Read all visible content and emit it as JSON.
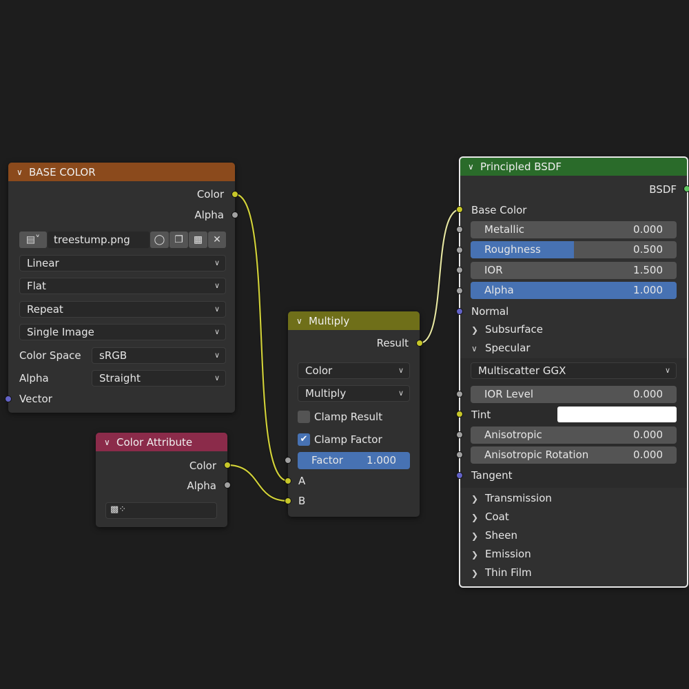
{
  "image_node": {
    "title": "BASE COLOR",
    "header_color": "#8b4a1c",
    "outputs": [
      "Color",
      "Alpha"
    ],
    "image_name": "treestump.png",
    "interpolation": "Linear",
    "projection": "Flat",
    "extension": "Repeat",
    "source": "Single Image",
    "color_space_label": "Color Space",
    "color_space": "sRGB",
    "alpha_label": "Alpha",
    "alpha_mode": "Straight",
    "vector_input": "Vector",
    "icons": [
      "image-browse-icon",
      "fake-user-shield-icon",
      "duplicate-icon",
      "pack-icon",
      "unlink-x-icon"
    ]
  },
  "color_attribute_node": {
    "title": "Color Attribute",
    "header_color": "#8b2b4a",
    "outputs": [
      "Color",
      "Alpha"
    ],
    "name_value": "",
    "icon": "color-attribute-icon"
  },
  "mix_node": {
    "title": "Multiply",
    "header_color": "#6f6f19",
    "output": "Result",
    "data_type": "Color",
    "blend_type": "Multiply",
    "clamp_result_label": "Clamp Result",
    "clamp_result": false,
    "clamp_factor_label": "Clamp Factor",
    "clamp_factor": true,
    "factor_label": "Factor",
    "factor_value": "1.000",
    "inputs": [
      "A",
      "B"
    ]
  },
  "bsdf_node": {
    "title": "Principled BSDF",
    "header_color": "#2a6b2a",
    "output": "BSDF",
    "base_color_label": "Base Color",
    "fields": [
      {
        "label": "Metallic",
        "value": "0.000",
        "fraction": 0.0
      },
      {
        "label": "Roughness",
        "value": "0.500",
        "fraction": 0.5
      },
      {
        "label": "IOR",
        "value": "1.500",
        "fraction": 0.0
      },
      {
        "label": "Alpha",
        "value": "1.000",
        "fraction": 1.0
      }
    ],
    "normal_label": "Normal",
    "subsurface_label": "Subsurface",
    "specular_label": "Specular",
    "distribution": "Multiscatter GGX",
    "specular_fields": [
      {
        "label": "IOR Level",
        "value": "0.000"
      },
      {
        "label": "Anisotropic",
        "value": "0.000"
      },
      {
        "label": "Anisotropic Rotation",
        "value": "0.000"
      }
    ],
    "tint_label": "Tint",
    "tint_color": "#ffffff",
    "tangent_label": "Tangent",
    "panels": [
      "Transmission",
      "Coat",
      "Sheen",
      "Emission",
      "Thin Film"
    ]
  },
  "colors": {
    "background": "#1d1d1d",
    "node_body": "#303030",
    "wire_color": "#c7c729",
    "selected_field": "#4772b3"
  }
}
